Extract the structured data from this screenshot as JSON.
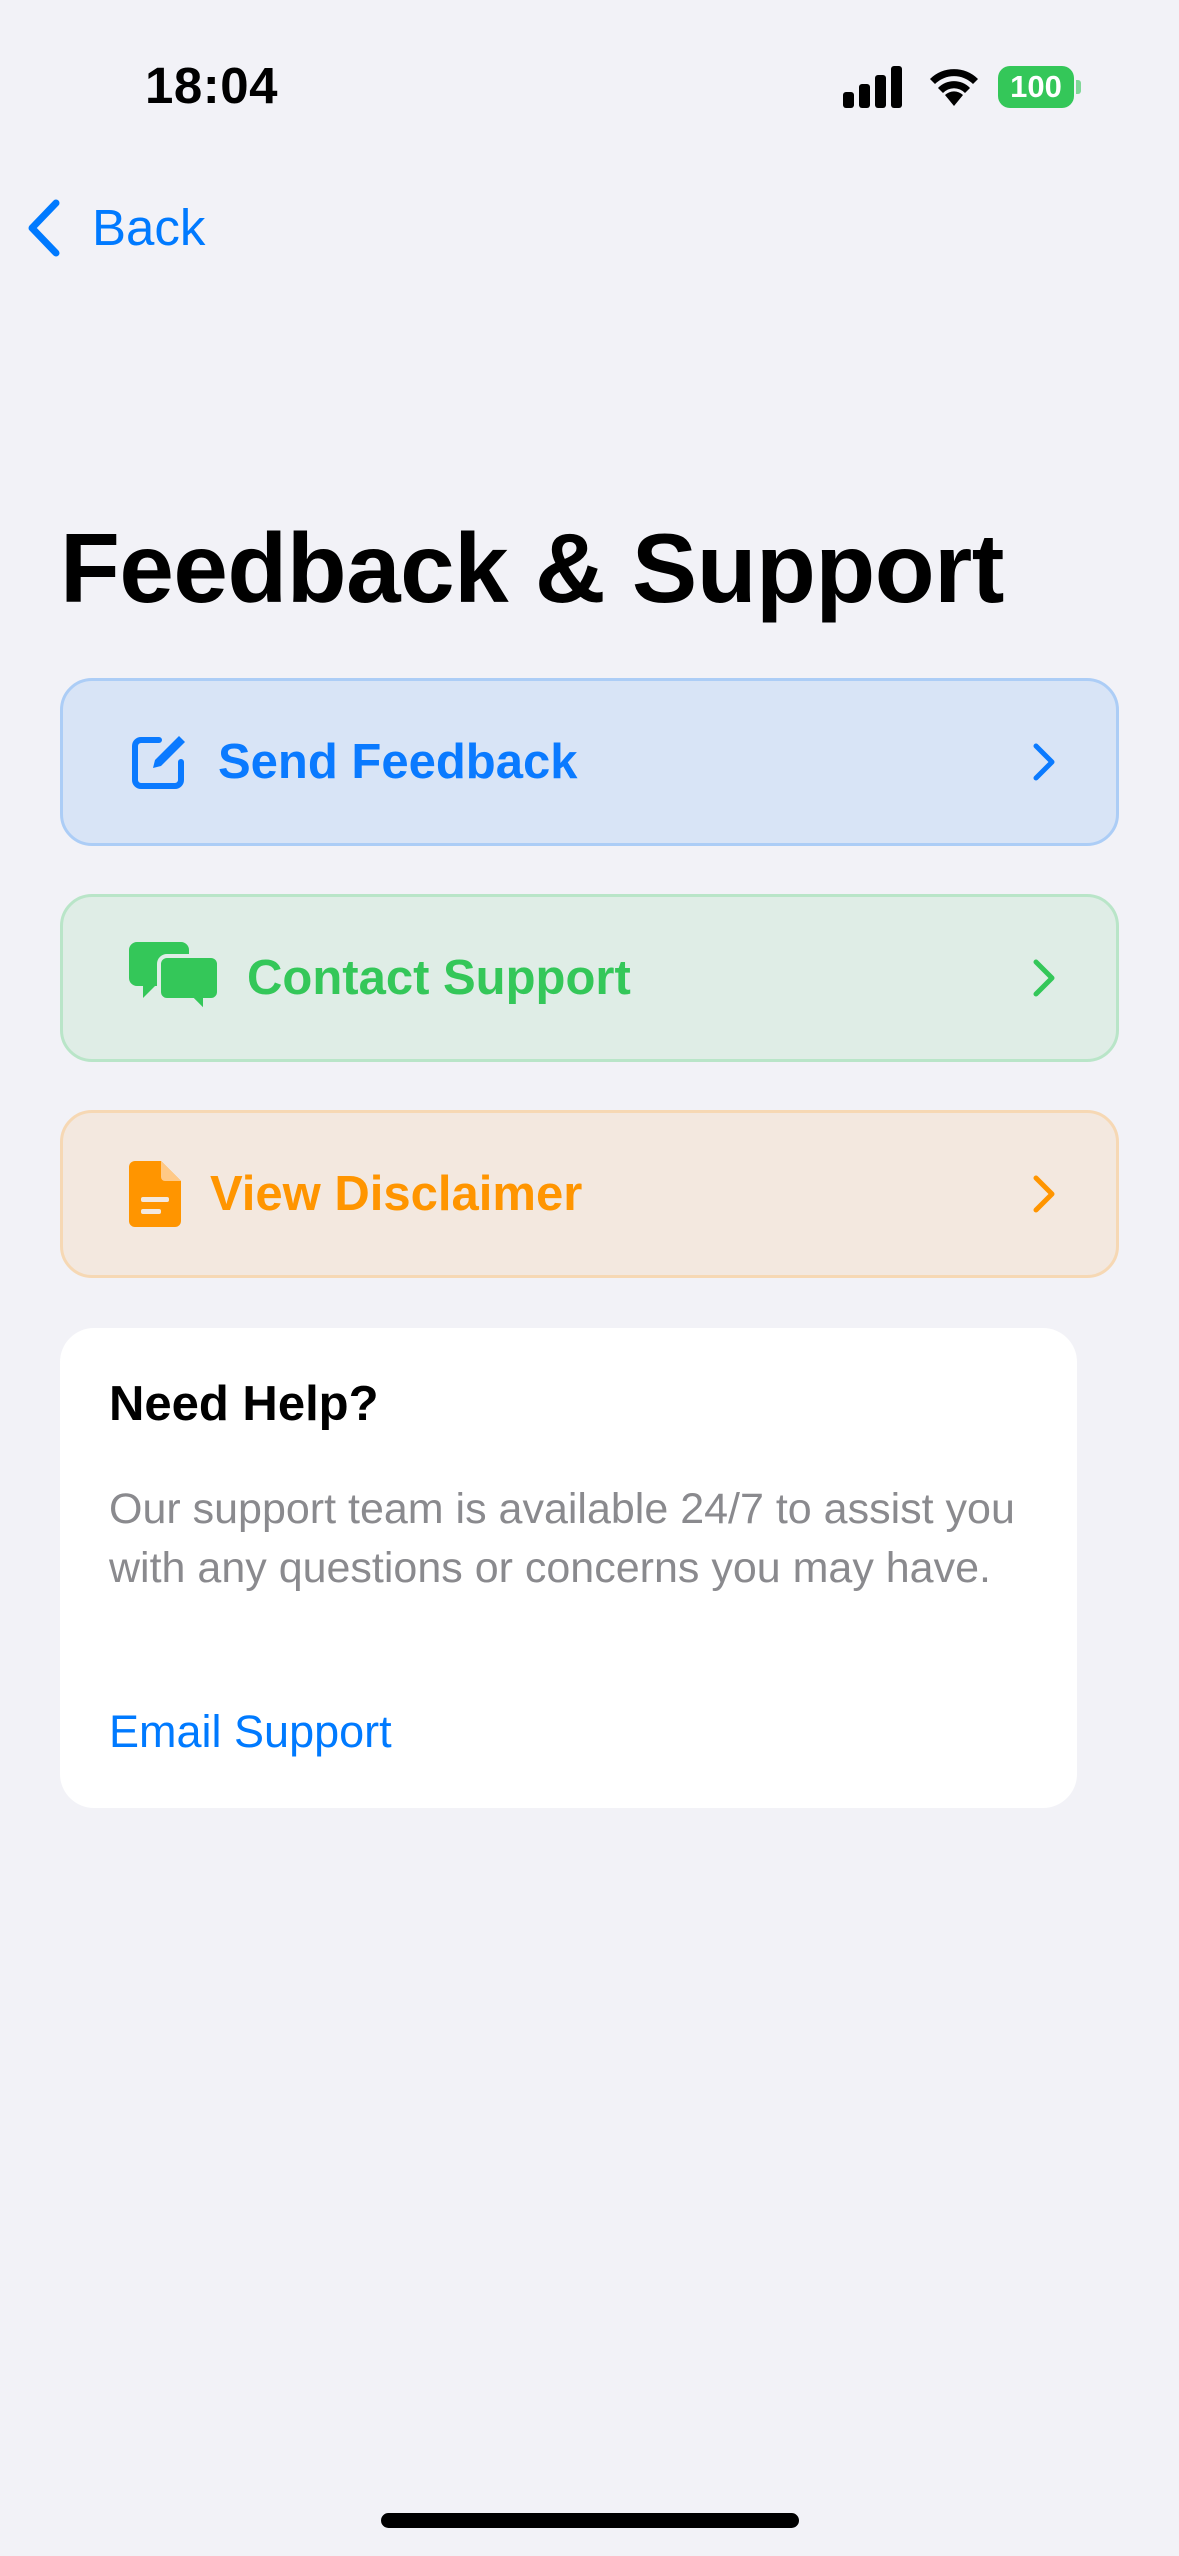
{
  "status_bar": {
    "time": "18:04",
    "battery_level": "100",
    "battery_color": "#34C759"
  },
  "nav": {
    "back_label": "Back",
    "back_icon": "chevron-left-icon"
  },
  "page": {
    "title": "Feedback & Support"
  },
  "actions": [
    {
      "label": "Send Feedback",
      "icon": "compose-icon",
      "color": "#0A7AFF"
    },
    {
      "label": "Contact Support",
      "icon": "chat-bubbles-icon",
      "color": "#34C759"
    },
    {
      "label": "View Disclaimer",
      "icon": "document-icon",
      "color": "#FF9500"
    }
  ],
  "help_card": {
    "title": "Need Help?",
    "body": "Our support team is available 24/7 to assist you with any questions or concerns you may have.",
    "link_label": "Email Support"
  },
  "colors": {
    "accent": "#007AFF",
    "background": "#F2F2F7",
    "secondary_text": "#8A8A8E"
  }
}
